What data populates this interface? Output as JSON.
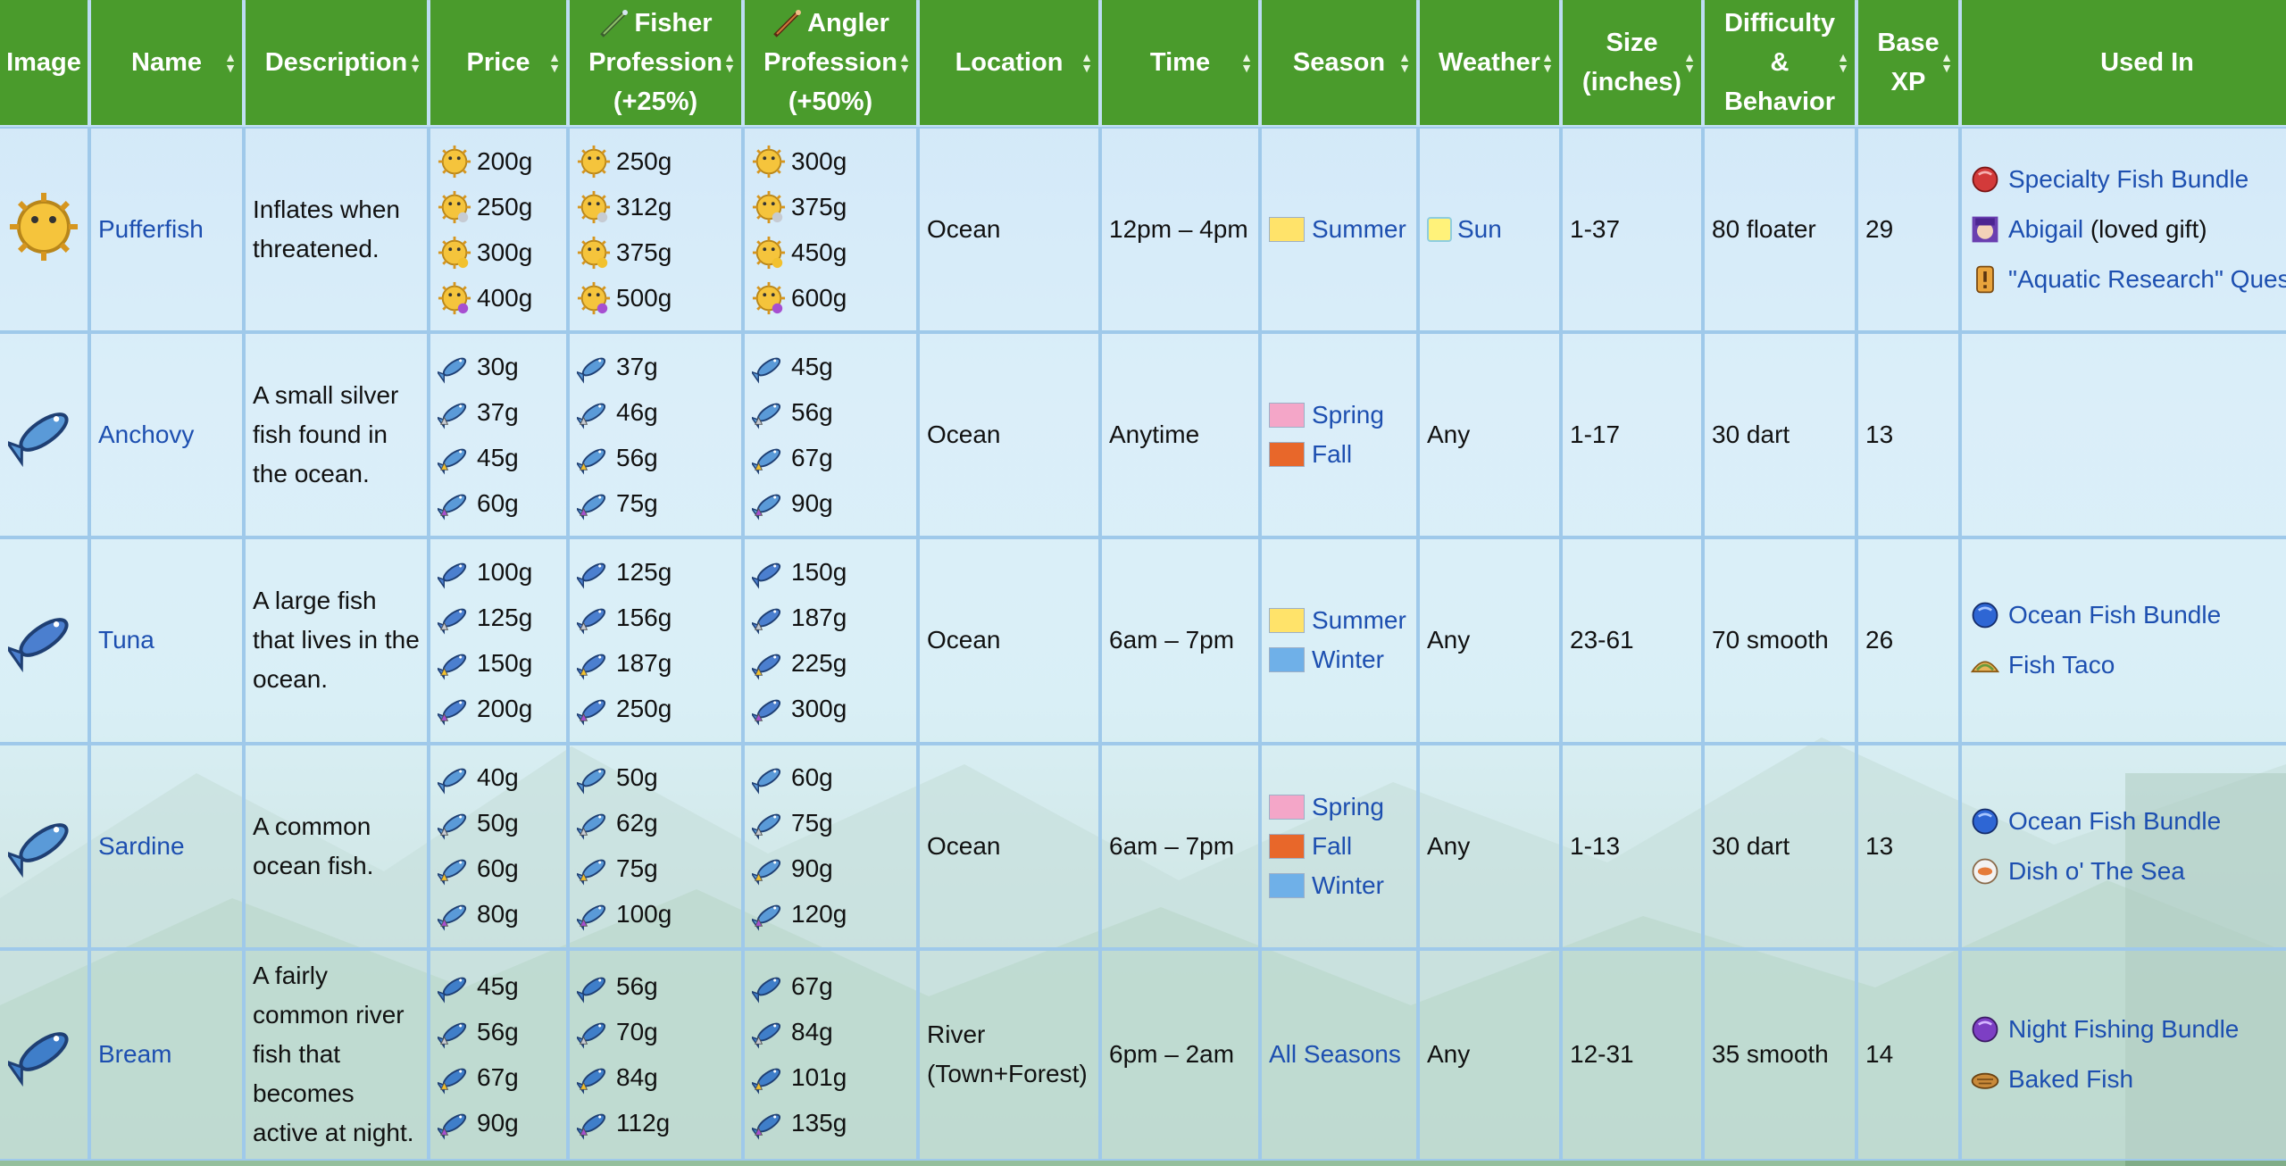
{
  "headers": {
    "image": "Image",
    "name": "Name",
    "description": "Description",
    "price": "Price",
    "fisher_l1": "Fisher",
    "fisher_l2": "Profession",
    "fisher_l3": "(+25%)",
    "angler_l1": "Angler",
    "angler_l2": "Profession",
    "angler_l3": "(+50%)",
    "location": "Location",
    "time": "Time",
    "season": "Season",
    "weather": "Weather",
    "size_l1": "Size",
    "size_l2": "(inches)",
    "diff_l1": "Difficulty",
    "diff_l2": "&",
    "diff_l3": "Behavior",
    "xp_l1": "Base",
    "xp_l2": "XP",
    "used_in": "Used In"
  },
  "colors": {
    "header_bg": "#4a9b2c",
    "link": "#1d4fb0",
    "quality_base": "#4a8fd6",
    "quality_silver": "#c6cbd3",
    "quality_gold": "#f2c12e",
    "quality_iridium": "#a64fd1"
  },
  "rows": [
    {
      "icon": "pufferfish-icon",
      "name": "Pufferfish",
      "description": "Inflates when threatened.",
      "price": [
        "200g",
        "250g",
        "300g",
        "400g"
      ],
      "fisher": [
        "250g",
        "312g",
        "375g",
        "500g"
      ],
      "angler": [
        "300g",
        "375g",
        "450g",
        "600g"
      ],
      "location": "Ocean",
      "time": "12pm – 4pm",
      "seasons": [
        "Summer"
      ],
      "weather": "Sun",
      "size": "1-37",
      "difficulty": "80 floater",
      "xp": "29",
      "used_in": [
        {
          "icon": "red-bundle-icon",
          "text": "Specialty Fish Bundle",
          "link": true
        },
        {
          "icon": "abigail-portrait-icon",
          "text": "Abigail",
          "suffix": " (loved gift)",
          "link": true
        },
        {
          "icon": "quest-icon",
          "text": "\"Aquatic Research\" Quest",
          "link": true
        }
      ]
    },
    {
      "icon": "anchovy-icon",
      "name": "Anchovy",
      "description": "A small silver fish found in the ocean.",
      "price": [
        "30g",
        "37g",
        "45g",
        "60g"
      ],
      "fisher": [
        "37g",
        "46g",
        "56g",
        "75g"
      ],
      "angler": [
        "45g",
        "56g",
        "67g",
        "90g"
      ],
      "location": "Ocean",
      "time": "Anytime",
      "seasons": [
        "Spring",
        "Fall"
      ],
      "weather": "Any",
      "size": "1-17",
      "difficulty": "30 dart",
      "xp": "13",
      "used_in": []
    },
    {
      "icon": "tuna-icon",
      "name": "Tuna",
      "description": "A large fish that lives in the ocean.",
      "price": [
        "100g",
        "125g",
        "150g",
        "200g"
      ],
      "fisher": [
        "125g",
        "156g",
        "187g",
        "250g"
      ],
      "angler": [
        "150g",
        "187g",
        "225g",
        "300g"
      ],
      "location": "Ocean",
      "time": "6am – 7pm",
      "seasons": [
        "Summer",
        "Winter"
      ],
      "weather": "Any",
      "size": "23-61",
      "difficulty": "70 smooth",
      "xp": "26",
      "used_in": [
        {
          "icon": "blue-bundle-icon",
          "text": "Ocean Fish Bundle",
          "link": true
        },
        {
          "icon": "fish-taco-icon",
          "text": "Fish Taco",
          "link": true
        }
      ]
    },
    {
      "icon": "sardine-icon",
      "name": "Sardine",
      "description": "A common ocean fish.",
      "price": [
        "40g",
        "50g",
        "60g",
        "80g"
      ],
      "fisher": [
        "50g",
        "62g",
        "75g",
        "100g"
      ],
      "angler": [
        "60g",
        "75g",
        "90g",
        "120g"
      ],
      "location": "Ocean",
      "time": "6am – 7pm",
      "seasons": [
        "Spring",
        "Fall",
        "Winter"
      ],
      "weather": "Any",
      "size": "1-13",
      "difficulty": "30 dart",
      "xp": "13",
      "used_in": [
        {
          "icon": "blue-bundle-icon",
          "text": "Ocean Fish Bundle",
          "link": true
        },
        {
          "icon": "dish-o-the-sea-icon",
          "text": "Dish o' The Sea",
          "link": true
        }
      ]
    },
    {
      "icon": "bream-icon",
      "name": "Bream",
      "description": "A fairly common river fish that becomes active at night.",
      "price": [
        "45g",
        "56g",
        "67g",
        "90g"
      ],
      "fisher": [
        "56g",
        "70g",
        "84g",
        "112g"
      ],
      "angler": [
        "67g",
        "84g",
        "101g",
        "135g"
      ],
      "location": "River (Town+Forest)",
      "time": "6pm – 2am",
      "seasons": [
        "All Seasons"
      ],
      "weather": "Any",
      "size": "12-31",
      "difficulty": "35 smooth",
      "xp": "14",
      "used_in": [
        {
          "icon": "purple-bundle-icon",
          "text": "Night Fishing Bundle",
          "link": true
        },
        {
          "icon": "baked-fish-icon",
          "text": "Baked Fish",
          "link": true
        }
      ]
    }
  ]
}
